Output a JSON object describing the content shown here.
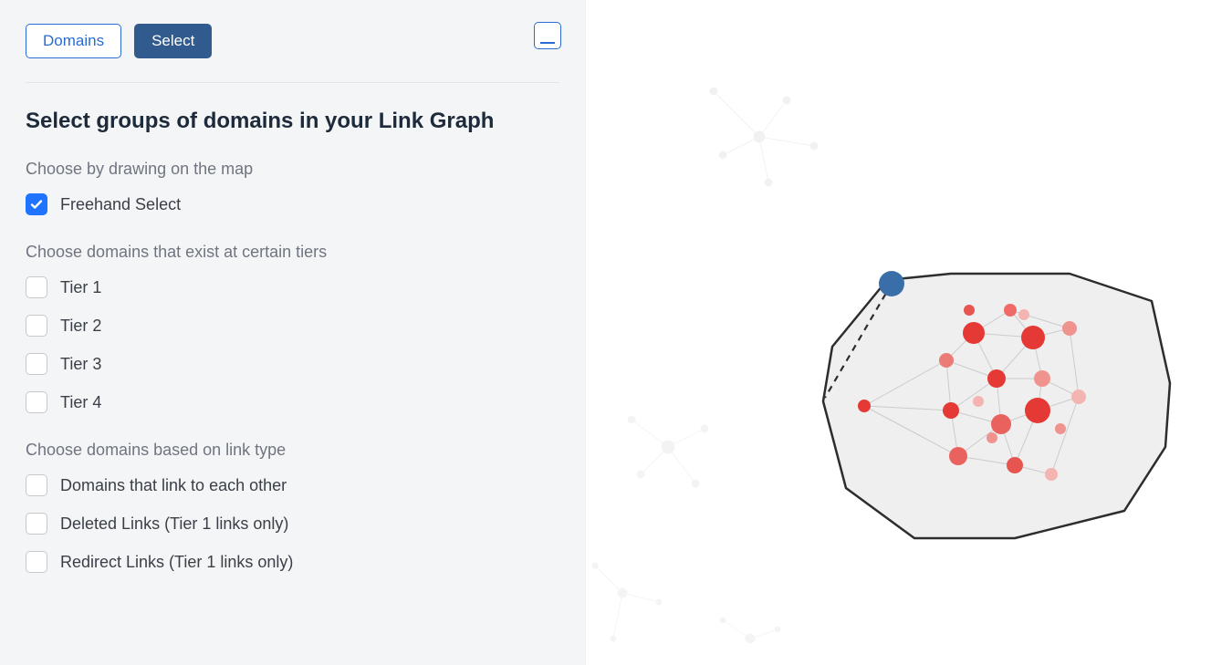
{
  "tabs": {
    "domains": "Domains",
    "select": "Select"
  },
  "title": "Select groups of domains in your Link Graph",
  "sections": {
    "draw_label": "Choose by drawing on the map",
    "tiers_label": "Choose domains that exist at certain tiers",
    "linktype_label": "Choose domains based on link type"
  },
  "options": {
    "freehand": "Freehand Select",
    "tier1": "Tier 1",
    "tier2": "Tier 2",
    "tier3": "Tier 3",
    "tier4": "Tier 4",
    "link_each_other": "Domains that link to each other",
    "deleted_links": "Deleted Links (Tier 1 links only)",
    "redirect_links": "Redirect Links (Tier 1 links only)"
  },
  "colors": {
    "accent": "#1e74ff",
    "tab_secondary": "#315b8f",
    "node_red": "#e53935",
    "node_blue": "#3a6ea8"
  }
}
